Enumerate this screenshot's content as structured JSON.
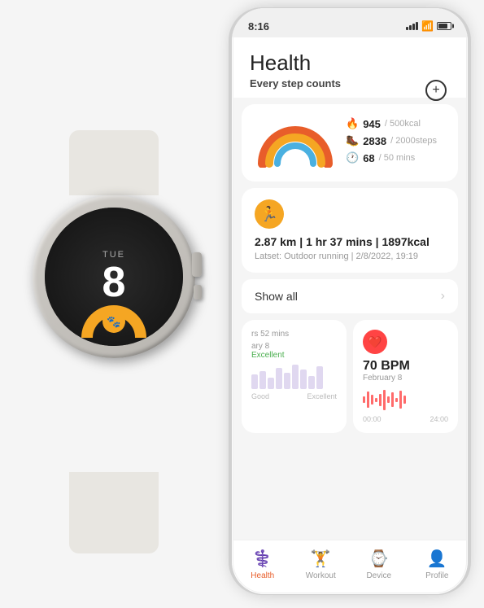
{
  "status_bar": {
    "time": "8:16"
  },
  "app": {
    "title": "Health",
    "subtitle_pre": "Every",
    "subtitle_bold": "step",
    "subtitle_post": "counts"
  },
  "health_rings": {
    "calories": {
      "value": "945",
      "goal": "/ 500kcal"
    },
    "steps": {
      "value": "2838",
      "goal": "/ 2000steps"
    },
    "minutes": {
      "value": "68",
      "goal": "/ 50 mins"
    }
  },
  "workout": {
    "stats": "2.87 km | 1 hr 37 mins | 1897kcal",
    "label_pre": "Latset:",
    "label_detail": "Outdoor running | 2/8/2022, 19:19"
  },
  "show_all": {
    "label": "Show all"
  },
  "sleep": {
    "duration": "52 mins",
    "date": "ary 8",
    "quality": "Excellent",
    "label_partial": "rs"
  },
  "heart": {
    "bpm": "70 BPM",
    "date": "February 8"
  },
  "nav": {
    "health": "Health",
    "workout": "Workout",
    "device": "Device",
    "profile": "Profile"
  },
  "watch": {
    "time": "8",
    "day": "TUE"
  },
  "colors": {
    "active": "#e85d2a",
    "orange": "#f5a623",
    "blue": "#4ab0e0",
    "red": "#ff4444",
    "green": "#4caf50"
  }
}
